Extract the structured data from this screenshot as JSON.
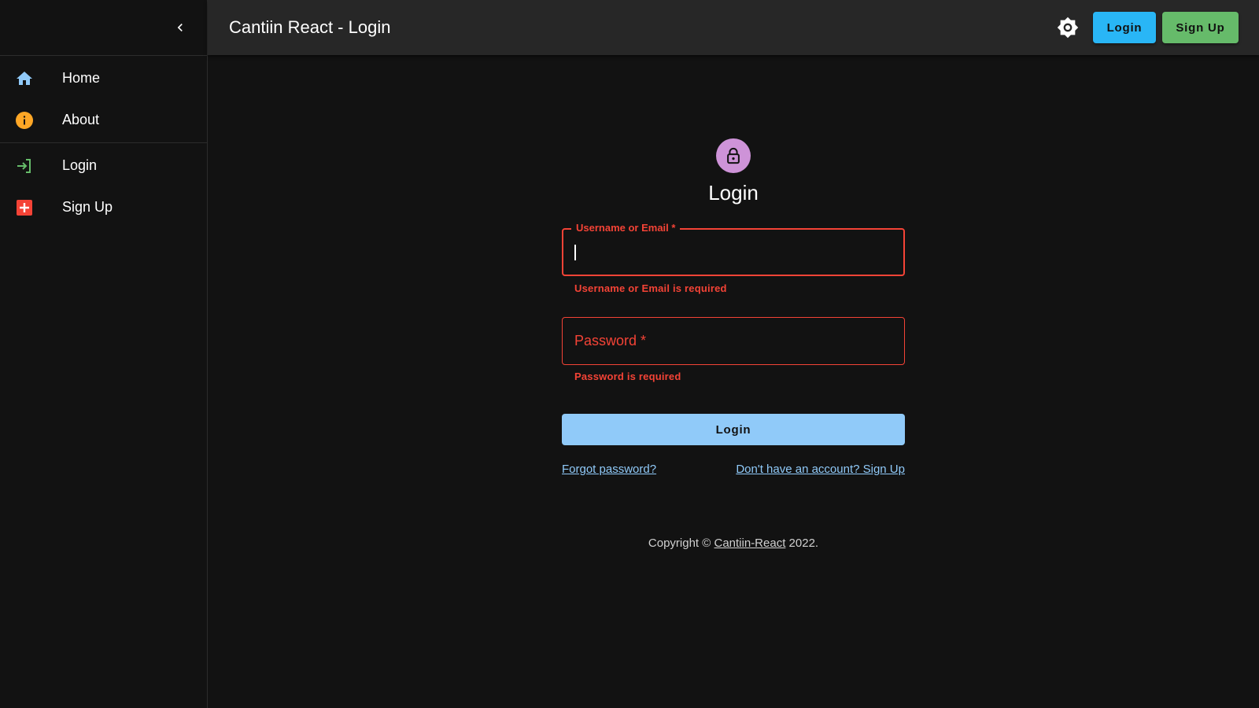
{
  "topbar": {
    "title": "Cantiin React - Login",
    "login_label": "Login",
    "signup_label": "Sign Up"
  },
  "sidebar": {
    "items": [
      {
        "label": "Home",
        "icon": "home-icon",
        "color": "#90caf9"
      },
      {
        "label": "About",
        "icon": "info-icon",
        "color": "#ffa726"
      },
      {
        "label": "Login",
        "icon": "login-icon",
        "color": "#66bb6a"
      },
      {
        "label": "Sign Up",
        "icon": "add-box-icon",
        "color": "#f44336"
      }
    ]
  },
  "form": {
    "title": "Login",
    "username_label": "Username or Email *",
    "username_value": "",
    "username_error": "Username or Email is required",
    "password_label": "Password *",
    "password_error": "Password is required",
    "submit_label": "Login",
    "forgot_link": "Forgot password?",
    "signup_link": "Don't have an account? Sign Up"
  },
  "footer": {
    "prefix": "Copyright © ",
    "brand": "Cantiin-React",
    "suffix": " 2022."
  },
  "colors": {
    "error": "#f44336",
    "primary_light": "#90caf9",
    "avatar": "#ce93d8",
    "appbar": "#272727",
    "background": "#121212"
  }
}
